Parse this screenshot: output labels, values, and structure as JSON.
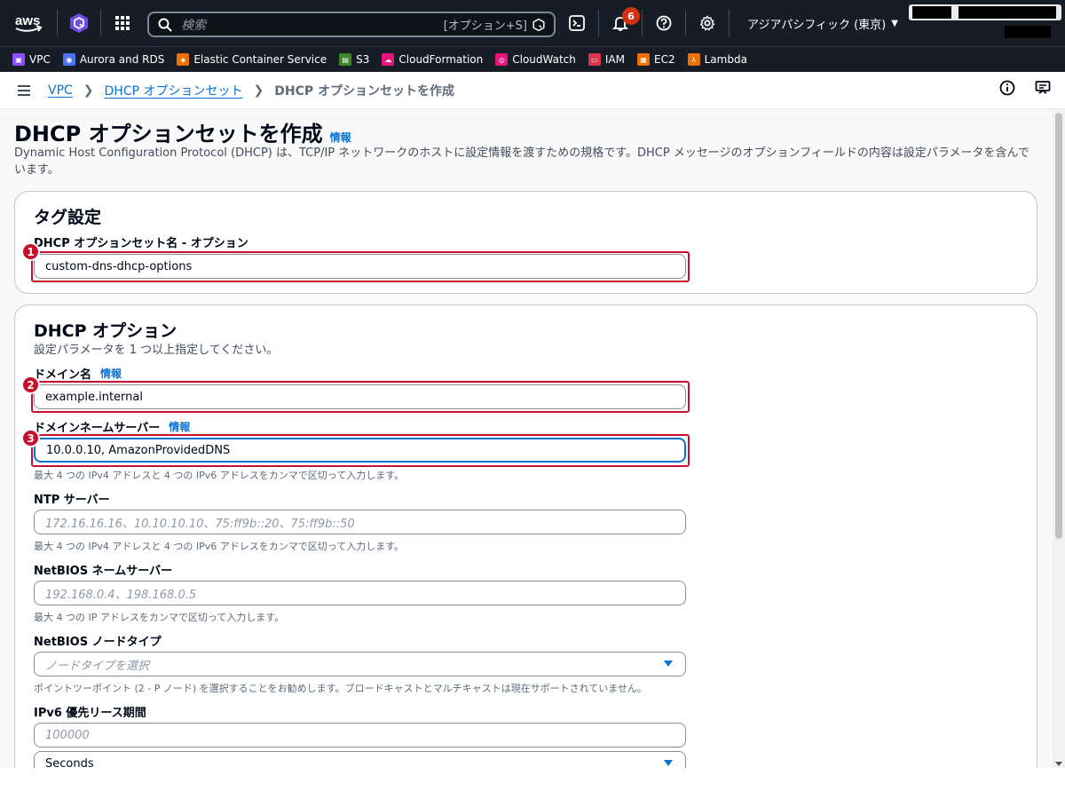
{
  "topnav": {
    "search_placeholder": "検索",
    "search_shortcut": "[オプション+S]",
    "notifications_count": "6",
    "region": "アジアパシフィック (東京)"
  },
  "favorites": [
    {
      "label": "VPC",
      "color": "#8c4fff"
    },
    {
      "label": "Aurora and RDS",
      "color": "#4d72f3"
    },
    {
      "label": "Elastic Container Service",
      "color": "#ed7100"
    },
    {
      "label": "S3",
      "color": "#3f8624"
    },
    {
      "label": "CloudFormation",
      "color": "#e7157b"
    },
    {
      "label": "CloudWatch",
      "color": "#e7157b"
    },
    {
      "label": "IAM",
      "color": "#dd344c"
    },
    {
      "label": "EC2",
      "color": "#ed7100"
    },
    {
      "label": "Lambda",
      "color": "#ed7100"
    }
  ],
  "breadcrumb": {
    "item1": "VPC",
    "item2": "DHCP オプションセット",
    "current": "DHCP オプションセットを作成"
  },
  "page": {
    "title": "DHCP オプションセットを作成",
    "info": "情報",
    "description": "Dynamic Host Configuration Protocol (DHCP) は、TCP/IP ネットワークのホストに設定情報を渡すための規格です。DHCP メッセージのオプションフィールドの内容は設定パラメータを含んでいます。"
  },
  "tag_panel": {
    "title": "タグ設定",
    "name_label": "DHCP オプションセット名 - オプション",
    "name_value": "custom-dns-dhcp-options"
  },
  "options_panel": {
    "title": "DHCP オプション",
    "subtitle": "設定パラメータを 1 つ以上指定してください。",
    "domain_label": "ドメイン名",
    "domain_info": "情報",
    "domain_value": "example.internal",
    "dns_label": "ドメインネームサーバー",
    "dns_info": "情報",
    "dns_value": "10.0.0.10, AmazonProvidedDNS",
    "dns_hint": "最大 4 つの IPv4 アドレスと 4 つの IPv6 アドレスをカンマで区切って入力します。",
    "ntp_label": "NTP サーバー",
    "ntp_placeholder": "172.16.16.16、10.10.10.10、75:ff9b::20、75:ff9b::50",
    "ntp_hint": "最大 4 つの IPv4 アドレスと 4 つの IPv6 アドレスをカンマで区切って入力します。",
    "netbios_label": "NetBIOS ネームサーバー",
    "netbios_placeholder": "192.168.0.4、198.168.0.5",
    "netbios_hint": "最大 4 つの IP アドレスをカンマで区切って入力します。",
    "nodetype_label": "NetBIOS ノードタイプ",
    "nodetype_placeholder": "ノードタイプを選択",
    "nodetype_hint": "ポイントツーポイント (2 - P ノード) を選択することをお勧めします。ブロードキャストとマルチキャストは現在サポートされていません。",
    "lease_label": "IPv6 優先リース期間",
    "lease_placeholder": "100000",
    "lease_unit": "Seconds"
  },
  "markers": [
    "1",
    "2",
    "3"
  ]
}
